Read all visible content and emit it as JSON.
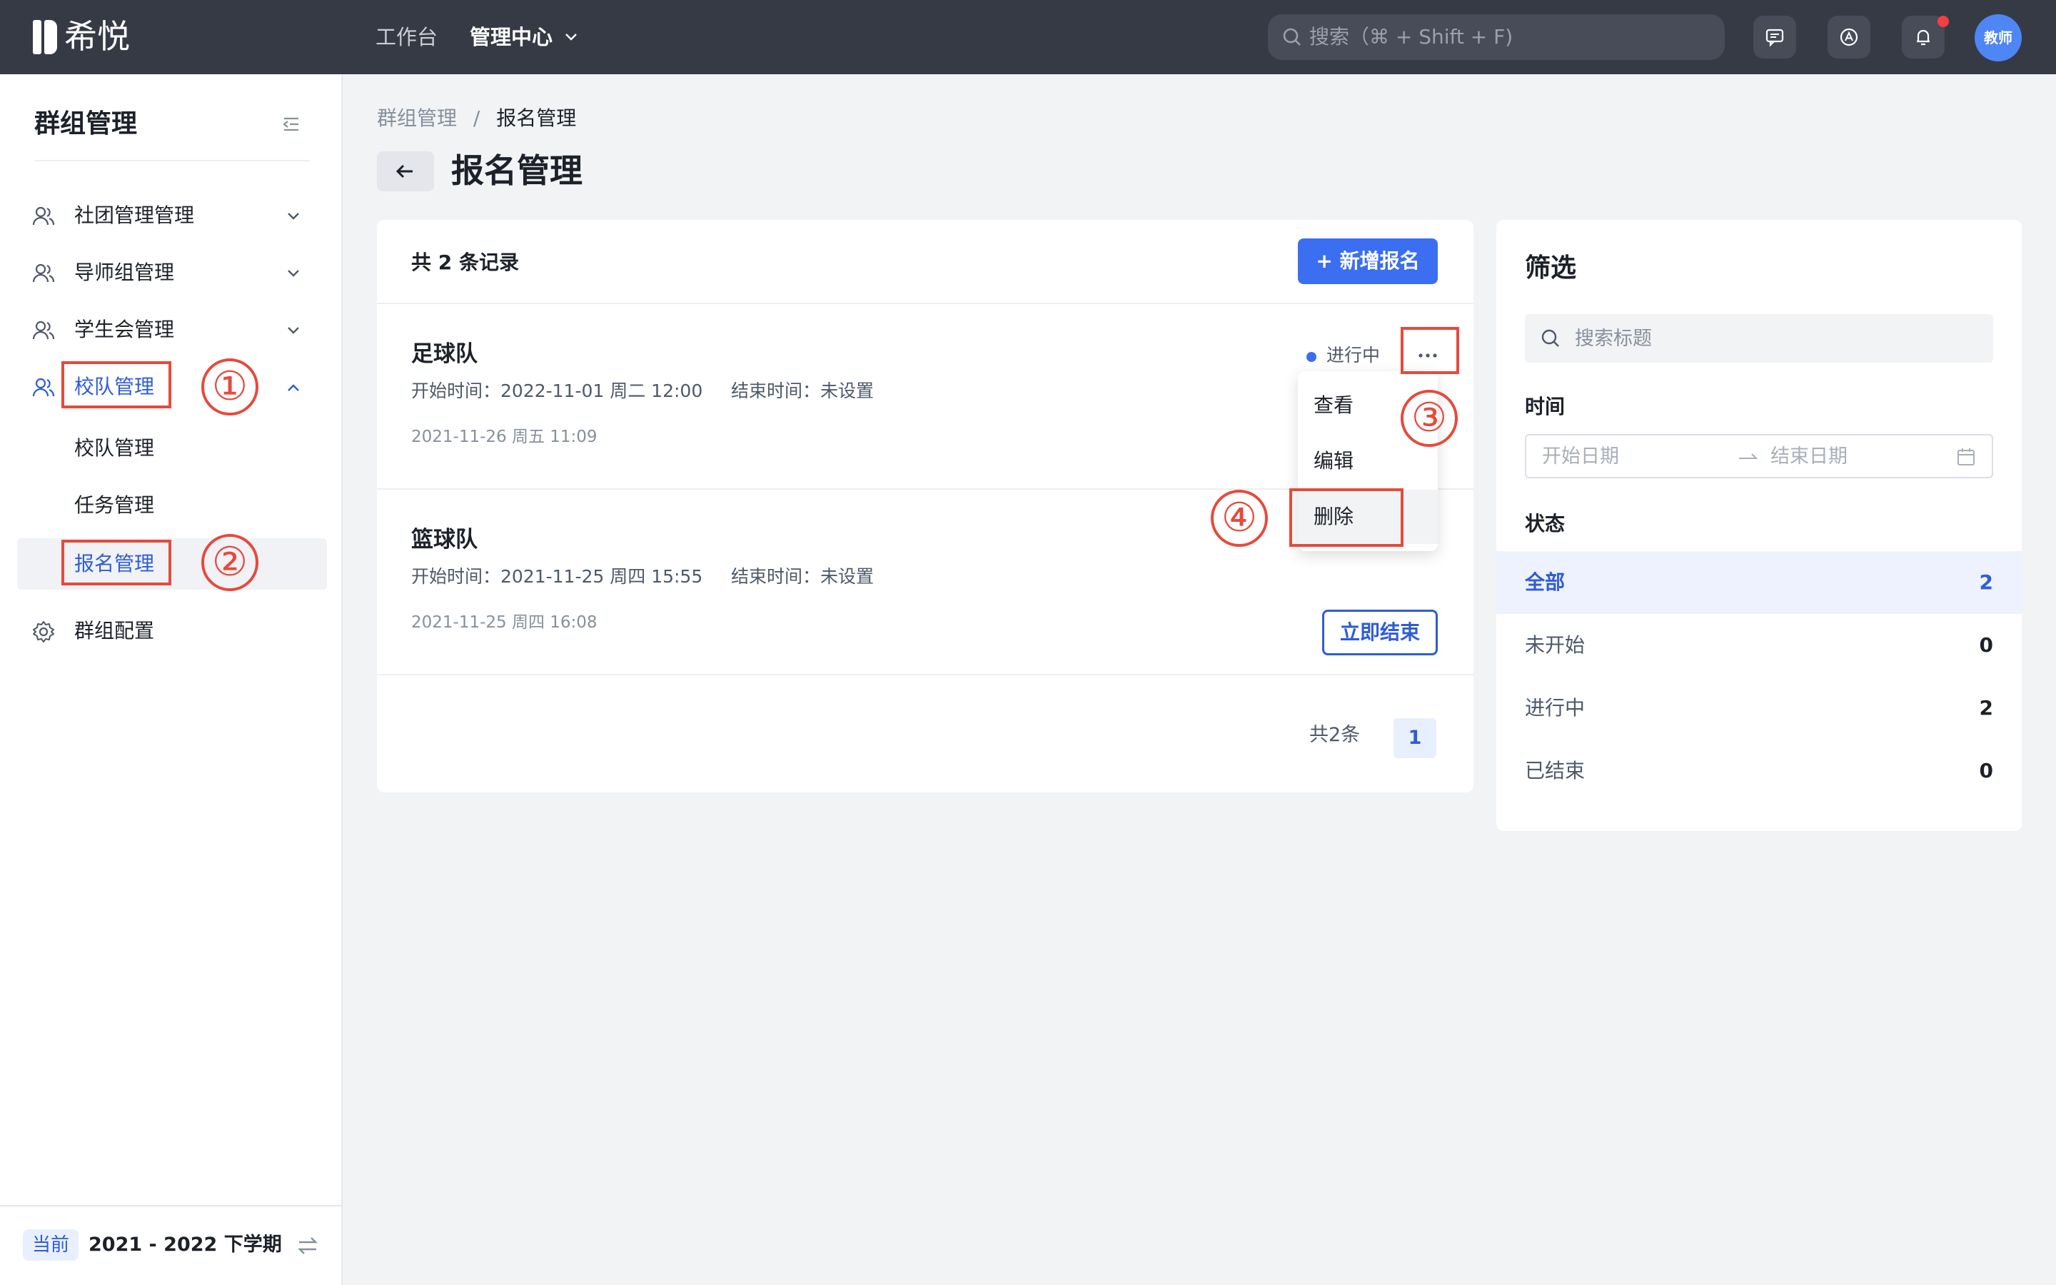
{
  "app": {
    "name": "希悦"
  },
  "topnav": {
    "items": [
      "工作台",
      "管理中心"
    ],
    "search_placeholder": "搜索（⌘ + Shift + F)",
    "avatar": "教师"
  },
  "sidebar": {
    "title": "群组管理",
    "groups": [
      {
        "label": "社团管理管理"
      },
      {
        "label": "导师组管理"
      },
      {
        "label": "学生会管理"
      },
      {
        "label": "校队管理",
        "children": [
          "校队管理",
          "任务管理",
          "报名管理"
        ]
      },
      {
        "label": "群组配置"
      }
    ],
    "term": {
      "tag": "当前",
      "text": "2021 - 2022 下学期"
    }
  },
  "annotations": [
    "①",
    "②",
    "③",
    "④"
  ],
  "breadcrumb": {
    "parent": "群组管理",
    "sep": "/",
    "current": "报名管理"
  },
  "page": {
    "title": "报名管理"
  },
  "list": {
    "count_label": "共 2 条记录",
    "add_label": "+ 新增报名",
    "items": [
      {
        "title": "足球队",
        "time": "开始时间：2022-11-01 周二 12:00     结束时间：未设置",
        "date": "2021-11-26 周五 11:09",
        "status": "进行中"
      },
      {
        "title": "篮球队",
        "time": "开始时间：2021-11-25 周四 15:55     结束时间：未设置",
        "date": "2021-11-25 周四 16:08",
        "action": "立即结束"
      }
    ],
    "total_label": "共2条",
    "page": "1"
  },
  "menu": {
    "items": [
      "查看",
      "编辑",
      "删除"
    ]
  },
  "filter": {
    "title": "筛选",
    "search_placeholder": "搜索标题",
    "time_label": "时间",
    "start_placeholder": "开始日期",
    "end_placeholder": "结束日期",
    "status_label": "状态",
    "statuses": [
      {
        "name": "全部",
        "count": "2"
      },
      {
        "name": "未开始",
        "count": "0"
      },
      {
        "name": "进行中",
        "count": "2"
      },
      {
        "name": "已结束",
        "count": "0"
      }
    ]
  },
  "colors": {
    "topbar": "#363a45",
    "accent": "#3b6ef0",
    "annotation": "#e64a3b"
  }
}
